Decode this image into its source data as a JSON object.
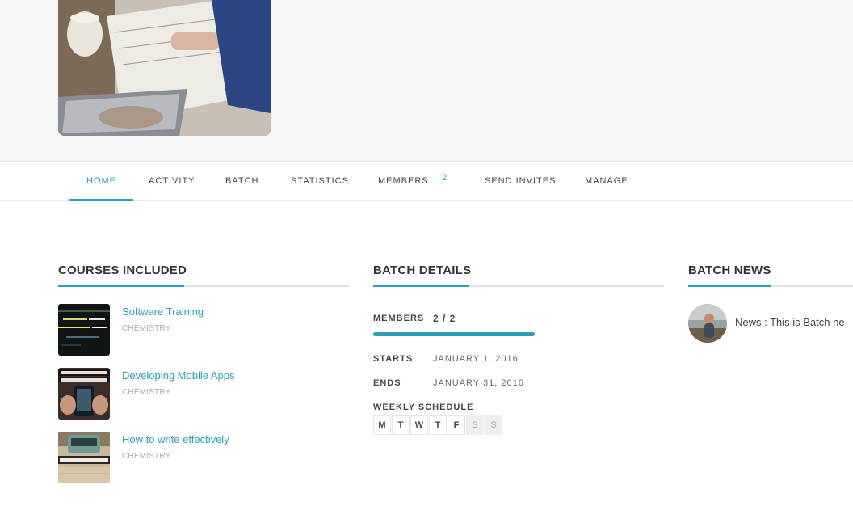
{
  "tabs": [
    {
      "label": "HOME",
      "active": true
    },
    {
      "label": "ACTIVITY"
    },
    {
      "label": "BATCH"
    },
    {
      "label": "STATISTICS"
    },
    {
      "label": "MEMBERS",
      "badge": "2"
    },
    {
      "label": "SEND INVITES"
    },
    {
      "label": "MANAGE"
    }
  ],
  "courses": {
    "title": "COURSES INCLUDED",
    "items": [
      {
        "title": "Software Training",
        "category": "CHEMISTRY",
        "thumb_text": "URL, the\n>Sign up today"
      },
      {
        "title": "Developing Mobile Apps",
        "category": "CHEMISTRY",
        "thumb_text": "RN TO DEVELOP\nILE APPLICATIO"
      },
      {
        "title": "How to write effectively",
        "category": "CHEMISTRY",
        "thumb_text": "FFECTIVE WRITI"
      }
    ]
  },
  "batch": {
    "title": "BATCH DETAILS",
    "members_label": "MEMBERS",
    "members_value": "2 / 2",
    "members_fill": 1.0,
    "starts_label": "STARTS",
    "starts_value": "JANUARY 1, 2016",
    "ends_label": "ENDS",
    "ends_value": "JANUARY 31, 2016",
    "schedule_label": "WEEKLY SCHEDULE",
    "days": [
      {
        "d": "M",
        "on": true
      },
      {
        "d": "T",
        "on": true
      },
      {
        "d": "W",
        "on": true
      },
      {
        "d": "T",
        "on": true
      },
      {
        "d": "F",
        "on": true
      },
      {
        "d": "S",
        "on": false
      },
      {
        "d": "S",
        "on": false
      }
    ]
  },
  "news": {
    "title": "BATCH NEWS",
    "item_text": "News : This is Batch ne"
  },
  "colors": {
    "accent": "#2d9fb8",
    "muted": "#aaaaaa"
  }
}
